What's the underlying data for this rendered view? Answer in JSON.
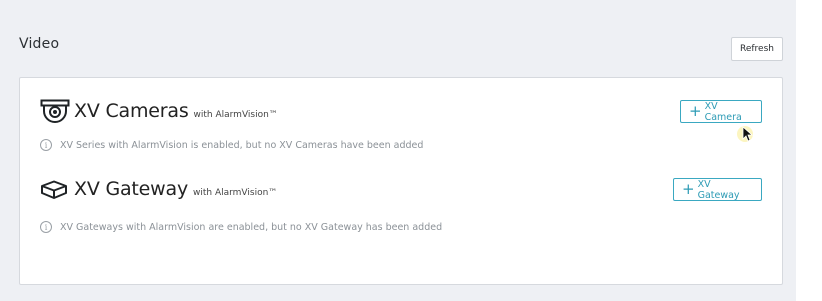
{
  "section": {
    "title": "Video",
    "refresh_label": "Refresh"
  },
  "items": [
    {
      "title": "XV Cameras",
      "subtitle": "with AlarmVision™",
      "icon": "dome-camera-icon",
      "info": "XV Series with AlarmVision is enabled, but no XV Cameras have been added",
      "button_label": "XV Camera"
    },
    {
      "title": "XV Gateway",
      "subtitle": "with AlarmVision™",
      "icon": "gateway-box-icon",
      "info": "XV Gateways with AlarmVision are enabled, but no XV Gateway has been added",
      "button_label": "XV Gateway"
    }
  ],
  "colors": {
    "accent": "#2d9bb5",
    "page_background": "#eef0f4",
    "muted_text": "#8b9197"
  }
}
